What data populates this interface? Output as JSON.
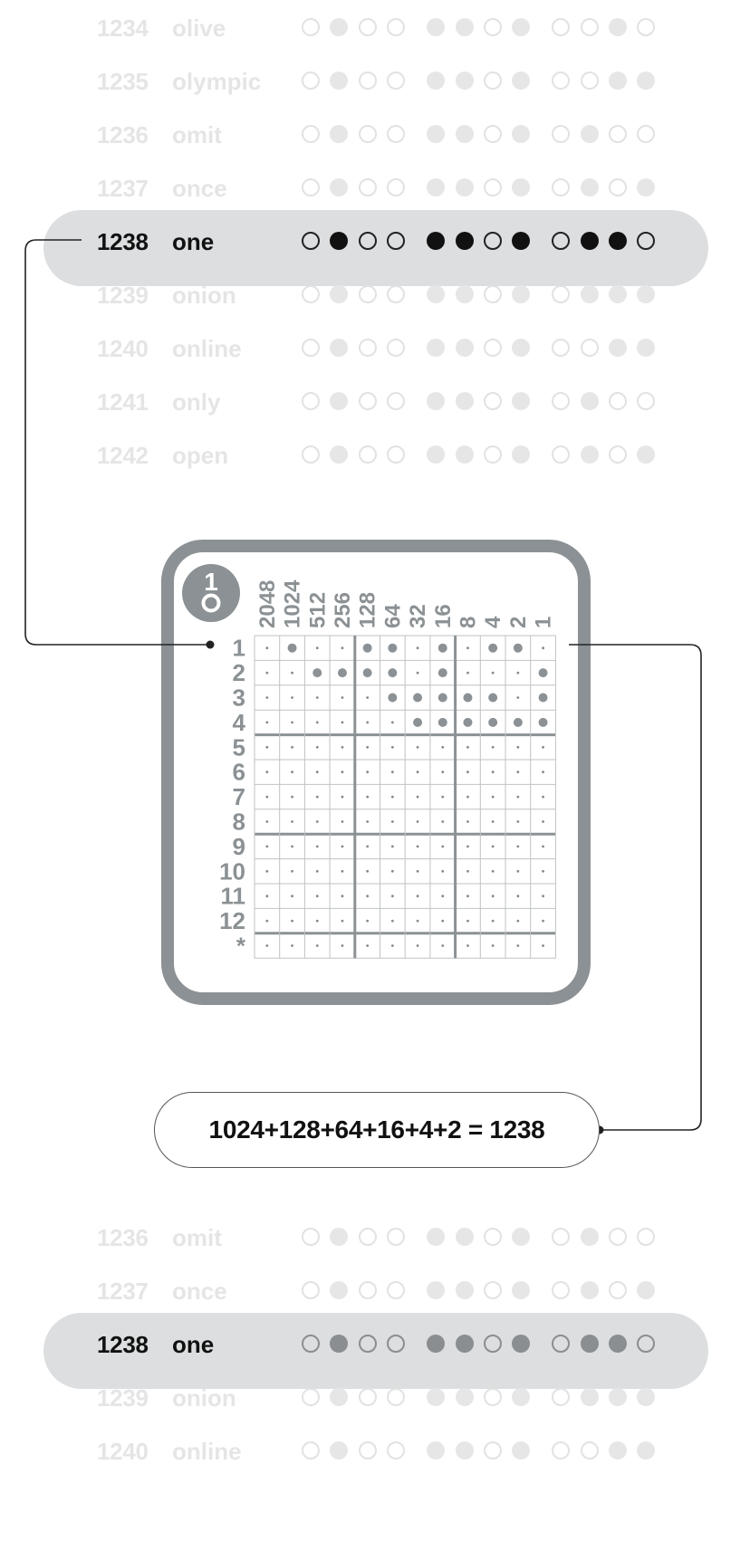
{
  "list_top": [
    {
      "num": "1234",
      "word": "olive",
      "bits": [
        0,
        1,
        0,
        0,
        1,
        1,
        0,
        1,
        0,
        0,
        1,
        0
      ],
      "state": "faded"
    },
    {
      "num": "1235",
      "word": "olympic",
      "bits": [
        0,
        1,
        0,
        0,
        1,
        1,
        0,
        1,
        0,
        0,
        1,
        1
      ],
      "state": "faded"
    },
    {
      "num": "1236",
      "word": "omit",
      "bits": [
        0,
        1,
        0,
        0,
        1,
        1,
        0,
        1,
        0,
        1,
        0,
        0
      ],
      "state": "faded"
    },
    {
      "num": "1237",
      "word": "once",
      "bits": [
        0,
        1,
        0,
        0,
        1,
        1,
        0,
        1,
        0,
        1,
        0,
        1
      ],
      "state": "faded"
    },
    {
      "num": "1238",
      "word": "one",
      "bits": [
        0,
        1,
        0,
        0,
        1,
        1,
        0,
        1,
        0,
        1,
        1,
        0
      ],
      "state": "active"
    },
    {
      "num": "1239",
      "word": "onion",
      "bits": [
        0,
        1,
        0,
        0,
        1,
        1,
        0,
        1,
        0,
        1,
        1,
        1
      ],
      "state": "faded"
    },
    {
      "num": "1240",
      "word": "online",
      "bits": [
        0,
        1,
        0,
        0,
        1,
        1,
        0,
        1,
        0,
        0,
        1,
        1
      ],
      "state": "faded"
    },
    {
      "num": "1241",
      "word": "only",
      "bits": [
        0,
        1,
        0,
        0,
        1,
        1,
        0,
        1,
        0,
        1,
        0,
        0
      ],
      "state": "faded"
    },
    {
      "num": "1242",
      "word": "open",
      "bits": [
        0,
        1,
        0,
        0,
        1,
        1,
        0,
        1,
        0,
        1,
        0,
        1
      ],
      "state": "faded"
    }
  ],
  "list_bottom": [
    {
      "num": "1236",
      "word": "omit",
      "bits": [
        0,
        1,
        0,
        0,
        1,
        1,
        0,
        1,
        0,
        1,
        0,
        0
      ],
      "state": "faded"
    },
    {
      "num": "1237",
      "word": "once",
      "bits": [
        0,
        1,
        0,
        0,
        1,
        1,
        0,
        1,
        0,
        1,
        0,
        1
      ],
      "state": "faded"
    },
    {
      "num": "1238",
      "word": "one",
      "bits": [
        0,
        1,
        0,
        0,
        1,
        1,
        0,
        1,
        0,
        1,
        1,
        0
      ],
      "state": "active2"
    },
    {
      "num": "1239",
      "word": "onion",
      "bits": [
        0,
        1,
        0,
        0,
        1,
        1,
        0,
        1,
        0,
        1,
        1,
        1
      ],
      "state": "faded"
    },
    {
      "num": "1240",
      "word": "online",
      "bits": [
        0,
        1,
        0,
        0,
        1,
        1,
        0,
        1,
        0,
        0,
        1,
        1
      ],
      "state": "faded"
    }
  ],
  "card": {
    "badge_text": "1",
    "column_headers": [
      "2048",
      "1024",
      "512",
      "256",
      "128",
      "64",
      "32",
      "16",
      "8",
      "4",
      "2",
      "1"
    ],
    "row_labels": [
      "1",
      "2",
      "3",
      "4",
      "5",
      "6",
      "7",
      "8",
      "9",
      "10",
      "11",
      "12",
      "*"
    ],
    "filled_rows": [
      [
        0,
        1,
        0,
        0,
        1,
        1,
        0,
        1,
        0,
        1,
        1,
        0
      ],
      [
        0,
        0,
        1,
        1,
        1,
        1,
        0,
        1,
        0,
        0,
        0,
        1
      ],
      [
        0,
        0,
        0,
        0,
        0,
        1,
        1,
        1,
        1,
        1,
        0,
        1
      ],
      [
        0,
        0,
        0,
        0,
        0,
        0,
        1,
        1,
        1,
        1,
        1,
        1
      ]
    ]
  },
  "sum": {
    "text": "1024+128+64+16+4+2 = 1238"
  },
  "colors": {
    "card_gray": "#8b9194",
    "pill_gray": "#dcdee0",
    "faded": "#e5e5e5",
    "dark": "#111111"
  }
}
